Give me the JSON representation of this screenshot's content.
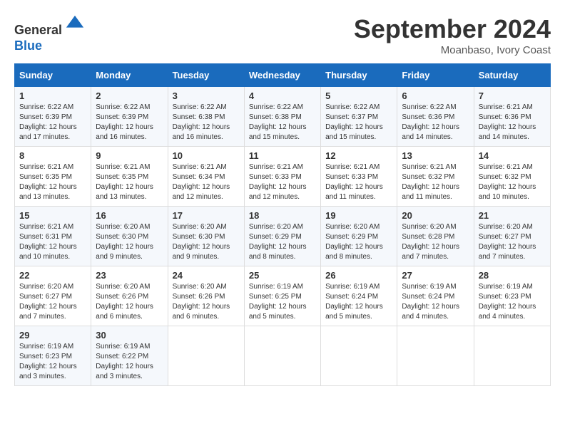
{
  "header": {
    "logo_line1": "General",
    "logo_line2": "Blue",
    "month_title": "September 2024",
    "location": "Moanbaso, Ivory Coast"
  },
  "days_of_week": [
    "Sunday",
    "Monday",
    "Tuesday",
    "Wednesday",
    "Thursday",
    "Friday",
    "Saturday"
  ],
  "weeks": [
    [
      {
        "day": 1,
        "sunrise": "6:22 AM",
        "sunset": "6:39 PM",
        "daylight": "12 hours and 17 minutes."
      },
      {
        "day": 2,
        "sunrise": "6:22 AM",
        "sunset": "6:39 PM",
        "daylight": "12 hours and 16 minutes."
      },
      {
        "day": 3,
        "sunrise": "6:22 AM",
        "sunset": "6:38 PM",
        "daylight": "12 hours and 16 minutes."
      },
      {
        "day": 4,
        "sunrise": "6:22 AM",
        "sunset": "6:38 PM",
        "daylight": "12 hours and 15 minutes."
      },
      {
        "day": 5,
        "sunrise": "6:22 AM",
        "sunset": "6:37 PM",
        "daylight": "12 hours and 15 minutes."
      },
      {
        "day": 6,
        "sunrise": "6:22 AM",
        "sunset": "6:36 PM",
        "daylight": "12 hours and 14 minutes."
      },
      {
        "day": 7,
        "sunrise": "6:21 AM",
        "sunset": "6:36 PM",
        "daylight": "12 hours and 14 minutes."
      }
    ],
    [
      {
        "day": 8,
        "sunrise": "6:21 AM",
        "sunset": "6:35 PM",
        "daylight": "12 hours and 13 minutes."
      },
      {
        "day": 9,
        "sunrise": "6:21 AM",
        "sunset": "6:35 PM",
        "daylight": "12 hours and 13 minutes."
      },
      {
        "day": 10,
        "sunrise": "6:21 AM",
        "sunset": "6:34 PM",
        "daylight": "12 hours and 12 minutes."
      },
      {
        "day": 11,
        "sunrise": "6:21 AM",
        "sunset": "6:33 PM",
        "daylight": "12 hours and 12 minutes."
      },
      {
        "day": 12,
        "sunrise": "6:21 AM",
        "sunset": "6:33 PM",
        "daylight": "12 hours and 11 minutes."
      },
      {
        "day": 13,
        "sunrise": "6:21 AM",
        "sunset": "6:32 PM",
        "daylight": "12 hours and 11 minutes."
      },
      {
        "day": 14,
        "sunrise": "6:21 AM",
        "sunset": "6:32 PM",
        "daylight": "12 hours and 10 minutes."
      }
    ],
    [
      {
        "day": 15,
        "sunrise": "6:21 AM",
        "sunset": "6:31 PM",
        "daylight": "12 hours and 10 minutes."
      },
      {
        "day": 16,
        "sunrise": "6:20 AM",
        "sunset": "6:30 PM",
        "daylight": "12 hours and 9 minutes."
      },
      {
        "day": 17,
        "sunrise": "6:20 AM",
        "sunset": "6:30 PM",
        "daylight": "12 hours and 9 minutes."
      },
      {
        "day": 18,
        "sunrise": "6:20 AM",
        "sunset": "6:29 PM",
        "daylight": "12 hours and 8 minutes."
      },
      {
        "day": 19,
        "sunrise": "6:20 AM",
        "sunset": "6:29 PM",
        "daylight": "12 hours and 8 minutes."
      },
      {
        "day": 20,
        "sunrise": "6:20 AM",
        "sunset": "6:28 PM",
        "daylight": "12 hours and 7 minutes."
      },
      {
        "day": 21,
        "sunrise": "6:20 AM",
        "sunset": "6:27 PM",
        "daylight": "12 hours and 7 minutes."
      }
    ],
    [
      {
        "day": 22,
        "sunrise": "6:20 AM",
        "sunset": "6:27 PM",
        "daylight": "12 hours and 7 minutes."
      },
      {
        "day": 23,
        "sunrise": "6:20 AM",
        "sunset": "6:26 PM",
        "daylight": "12 hours and 6 minutes."
      },
      {
        "day": 24,
        "sunrise": "6:20 AM",
        "sunset": "6:26 PM",
        "daylight": "12 hours and 6 minutes."
      },
      {
        "day": 25,
        "sunrise": "6:19 AM",
        "sunset": "6:25 PM",
        "daylight": "12 hours and 5 minutes."
      },
      {
        "day": 26,
        "sunrise": "6:19 AM",
        "sunset": "6:24 PM",
        "daylight": "12 hours and 5 minutes."
      },
      {
        "day": 27,
        "sunrise": "6:19 AM",
        "sunset": "6:24 PM",
        "daylight": "12 hours and 4 minutes."
      },
      {
        "day": 28,
        "sunrise": "6:19 AM",
        "sunset": "6:23 PM",
        "daylight": "12 hours and 4 minutes."
      }
    ],
    [
      {
        "day": 29,
        "sunrise": "6:19 AM",
        "sunset": "6:23 PM",
        "daylight": "12 hours and 3 minutes."
      },
      {
        "day": 30,
        "sunrise": "6:19 AM",
        "sunset": "6:22 PM",
        "daylight": "12 hours and 3 minutes."
      },
      null,
      null,
      null,
      null,
      null
    ]
  ]
}
